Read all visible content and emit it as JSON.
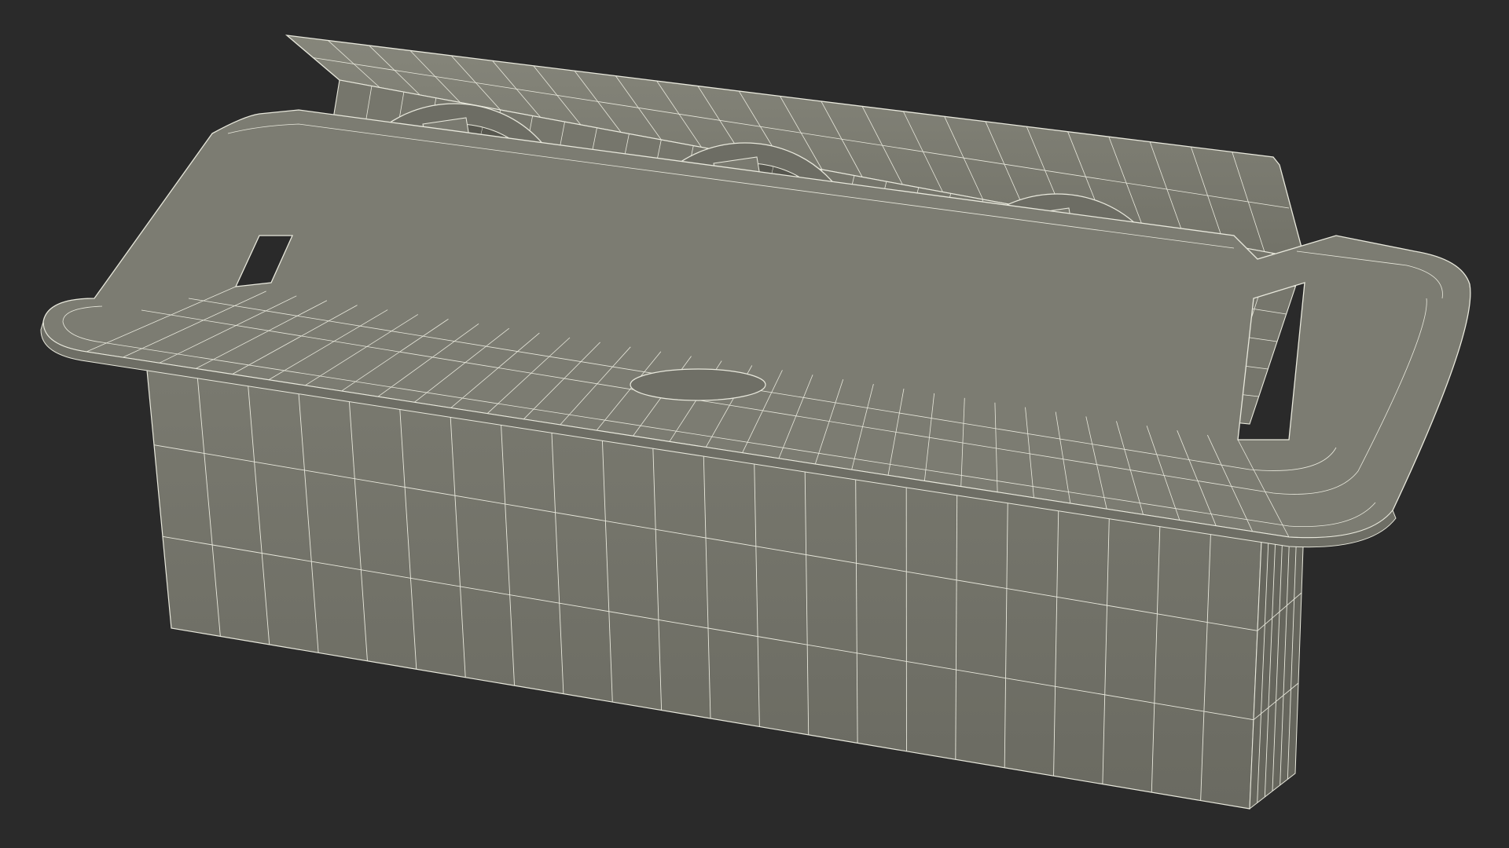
{
  "scene": {
    "subject": "pop-up-desk-socket-wireframe",
    "socket_count": 3,
    "colors": {
      "background": "#2a2a2a",
      "body": "#77776c",
      "body_light": "#8a8a7f",
      "body_dark": "#5f5f56",
      "wire": "#e8e8dc",
      "wire_dim": "#b7b7ab"
    }
  }
}
